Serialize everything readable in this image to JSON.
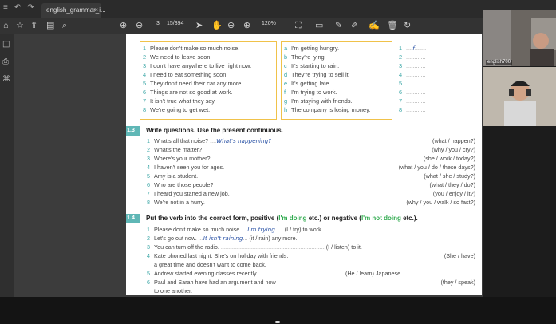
{
  "window": {
    "tab_title": "english_grammar_i...",
    "close_glyph": "×"
  },
  "toolbar": {
    "page_current": "3",
    "page_total": "15/394",
    "zoom": "120%"
  },
  "videos": [
    {
      "name": "english700"
    },
    {
      "name": ""
    }
  ],
  "matching": {
    "left": [
      "Please don't make so much noise.",
      "We need to leave soon.",
      "I don't have anywhere to live right now.",
      "I need to eat something soon.",
      "They don't need their car any more.",
      "Things are not so good at work.",
      "It isn't true what they say.",
      "We're going to get wet."
    ],
    "right_letters": [
      "a",
      "b",
      "c",
      "d",
      "e",
      "f",
      "g",
      "h"
    ],
    "right": [
      "I'm getting hungry.",
      "They're lying.",
      "It's starting to rain.",
      "They're trying to sell it.",
      "It's getting late.",
      "I'm trying to work.",
      "I'm staying with friends.",
      "The company is losing money."
    ],
    "answer_first": "f"
  },
  "ex13": {
    "label": "1.3",
    "title": "Write questions.  Use the present continuous.",
    "items": [
      {
        "q": "What's all that noise?",
        "answer": "What's happening?",
        "hint": "(what / happen?)"
      },
      {
        "q": "What's the matter?",
        "answer": "",
        "hint": "(why / you / cry?)"
      },
      {
        "q": "Where's your mother?",
        "answer": "",
        "hint": "(she / work / today?)"
      },
      {
        "q": "I haven't seen you for ages.",
        "answer": "",
        "hint": "(what / you / do / these days?)"
      },
      {
        "q": "Amy is a student.",
        "answer": "",
        "hint": "(what / she / study?)"
      },
      {
        "q": "Who are those people?",
        "answer": "",
        "hint": "(what / they / do?)"
      },
      {
        "q": "I heard you started a new job.",
        "answer": "",
        "hint": "(you / enjoy / it?)"
      },
      {
        "q": "We're not in a hurry.",
        "answer": "",
        "hint": "(why / you / walk / so fast?)"
      }
    ]
  },
  "ex14": {
    "label": "1.4",
    "title_a": "Put the verb into the correct form, positive (",
    "title_b": "I'm doing",
    "title_c": " etc.) or negative (",
    "title_d": "I'm not doing",
    "title_e": " etc.).",
    "items": [
      {
        "q": "Please don't make so much noise.",
        "answer": "I'm trying",
        "hint": "(I / try) to work."
      },
      {
        "q": "Let's go out now.",
        "answer": "It isn't raining",
        "hint": "(it / rain) any more."
      },
      {
        "q": "You can turn off the radio.",
        "answer": "",
        "hint": "(I / listen) to it."
      },
      {
        "q": "Kate phoned last night.  She's on holiday with friends.",
        "answer": "",
        "hint": "(She / have)"
      },
      {
        "q": "a great time and doesn't want to come back.",
        "answer": "",
        "hint": ""
      },
      {
        "q": "Andrew started evening classes recently.",
        "answer": "",
        "hint": "(He / learn) Japanese."
      },
      {
        "q": "Paul and Sarah have had an argument and now",
        "answer": "",
        "hint": "(they / speak)"
      },
      {
        "q": "to one another.",
        "answer": "",
        "hint": ""
      }
    ],
    "item_numbers": [
      "1",
      "2",
      "3",
      "4",
      "",
      "5",
      "6",
      ""
    ]
  }
}
